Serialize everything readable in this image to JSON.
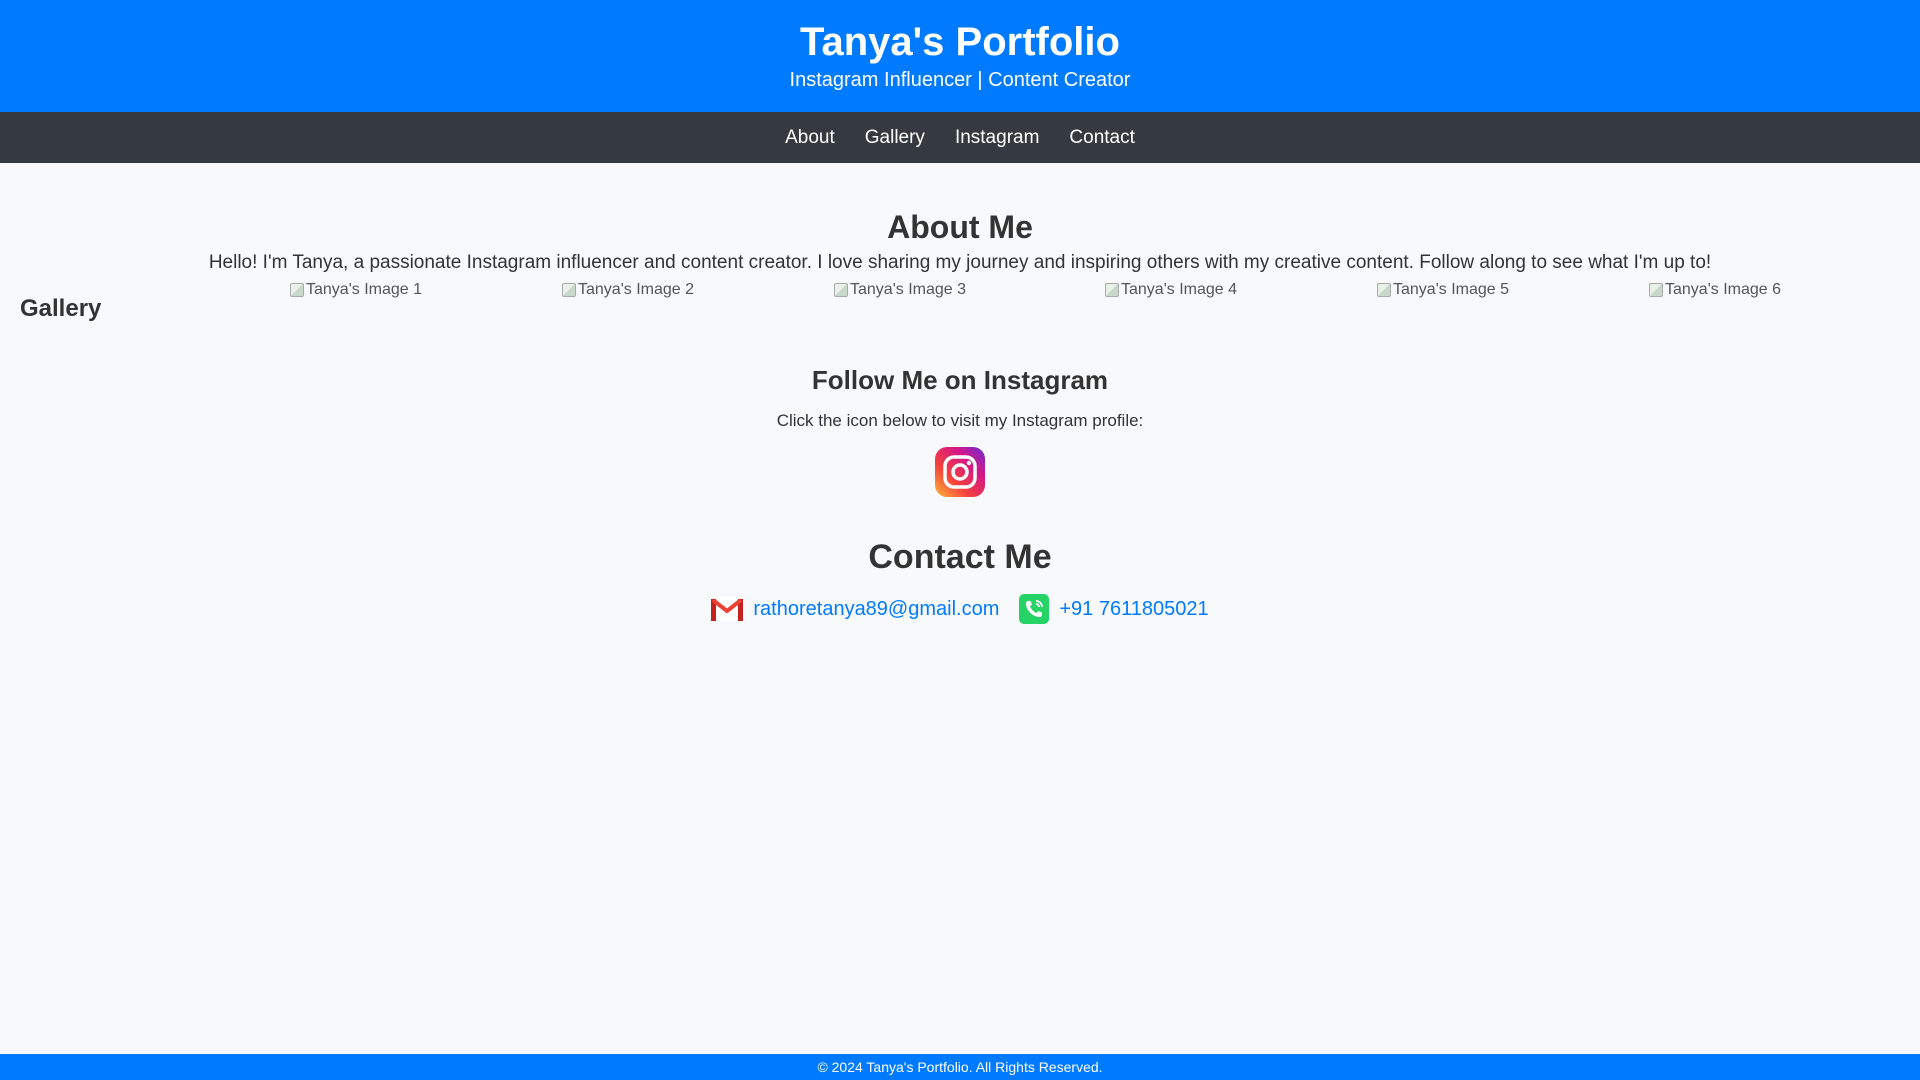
{
  "header": {
    "title": "Tanya's Portfolio",
    "subtitle": "Instagram Influencer | Content Creator"
  },
  "nav": {
    "items": [
      "About",
      "Gallery",
      "Instagram",
      "Contact"
    ]
  },
  "about": {
    "heading": "About Me",
    "text": "Hello! I'm Tanya, a passionate Instagram influencer and content creator. I love sharing my journey and inspiring others with my creative content. Follow along to see what I'm up to!"
  },
  "gallery": {
    "heading": "Gallery",
    "images": [
      "Tanya's Image 1",
      "Tanya's Image 2",
      "Tanya's Image 3",
      "Tanya's Image 4",
      "Tanya's Image 5",
      "Tanya's Image 6"
    ]
  },
  "instagram": {
    "heading": "Follow Me on Instagram",
    "text": "Click the icon below to visit my Instagram profile:",
    "icon": "instagram-icon"
  },
  "contact": {
    "heading": "Contact Me",
    "email": "rathoretanya89@gmail.com",
    "email_icon": "gmail-icon",
    "phone": "+91 7611805021",
    "phone_icon": "phone-icon"
  },
  "footer": {
    "text": "© 2024 Tanya's Portfolio. All Rights Reserved."
  },
  "colors": {
    "primary": "#007bff",
    "nav_bg": "#343a40",
    "page_bg": "#f8f9fa"
  }
}
